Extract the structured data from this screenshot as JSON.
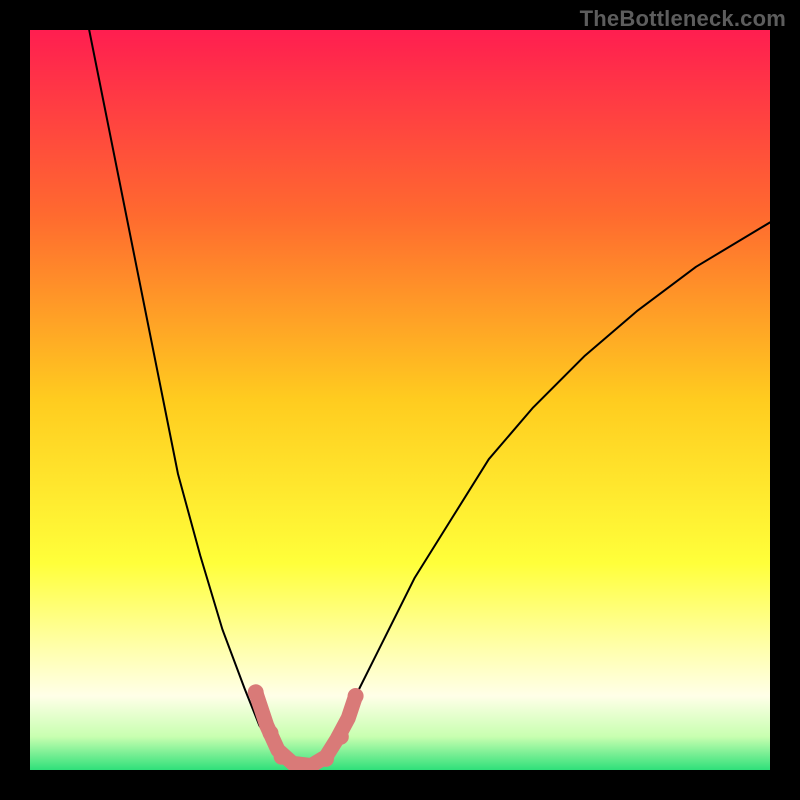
{
  "watermark": "TheBottleneck.com",
  "chart_data": {
    "type": "line",
    "title": "",
    "xlabel": "",
    "ylabel": "",
    "xlim": [
      0,
      100
    ],
    "ylim": [
      0,
      100
    ],
    "background_gradient": [
      {
        "pos": 0.0,
        "color": "#ff1e50"
      },
      {
        "pos": 0.25,
        "color": "#ff6a2f"
      },
      {
        "pos": 0.5,
        "color": "#ffcc1f"
      },
      {
        "pos": 0.72,
        "color": "#ffff3a"
      },
      {
        "pos": 0.84,
        "color": "#ffffb0"
      },
      {
        "pos": 0.9,
        "color": "#ffffe8"
      },
      {
        "pos": 0.955,
        "color": "#c8ffb0"
      },
      {
        "pos": 1.0,
        "color": "#2fe07a"
      }
    ],
    "series": [
      {
        "name": "left-curve",
        "color": "#000000",
        "width": 2,
        "points": [
          {
            "x": 8,
            "y": 100
          },
          {
            "x": 10,
            "y": 90
          },
          {
            "x": 12,
            "y": 80
          },
          {
            "x": 14,
            "y": 70
          },
          {
            "x": 16,
            "y": 60
          },
          {
            "x": 18,
            "y": 50
          },
          {
            "x": 20,
            "y": 40
          },
          {
            "x": 23,
            "y": 29
          },
          {
            "x": 26,
            "y": 19
          },
          {
            "x": 29,
            "y": 11
          },
          {
            "x": 31,
            "y": 6
          },
          {
            "x": 33,
            "y": 3
          },
          {
            "x": 35,
            "y": 1
          },
          {
            "x": 37,
            "y": 0
          }
        ]
      },
      {
        "name": "right-curve",
        "color": "#000000",
        "width": 2,
        "points": [
          {
            "x": 37,
            "y": 0
          },
          {
            "x": 39,
            "y": 1
          },
          {
            "x": 41,
            "y": 4
          },
          {
            "x": 44,
            "y": 10
          },
          {
            "x": 48,
            "y": 18
          },
          {
            "x": 52,
            "y": 26
          },
          {
            "x": 57,
            "y": 34
          },
          {
            "x": 62,
            "y": 42
          },
          {
            "x": 68,
            "y": 49
          },
          {
            "x": 75,
            "y": 56
          },
          {
            "x": 82,
            "y": 62
          },
          {
            "x": 90,
            "y": 68
          },
          {
            "x": 100,
            "y": 74
          }
        ]
      },
      {
        "name": "marker-trail",
        "color": "#d97a78",
        "width": 15,
        "points": [
          {
            "x": 30.5,
            "y": 10.5
          },
          {
            "x": 32.0,
            "y": 6.0
          },
          {
            "x": 33.5,
            "y": 2.7
          },
          {
            "x": 35.5,
            "y": 0.9
          },
          {
            "x": 38.0,
            "y": 0.6
          },
          {
            "x": 40.0,
            "y": 1.8
          },
          {
            "x": 41.5,
            "y": 4.2
          },
          {
            "x": 43.0,
            "y": 7.0
          },
          {
            "x": 44.0,
            "y": 10.0
          }
        ]
      }
    ],
    "markers": [
      {
        "x": 30.5,
        "y": 10.5,
        "r": 8,
        "color": "#d97a78"
      },
      {
        "x": 32.5,
        "y": 5.0,
        "r": 8,
        "color": "#d97a78"
      },
      {
        "x": 34.0,
        "y": 1.8,
        "r": 8,
        "color": "#d97a78"
      },
      {
        "x": 37.0,
        "y": 0.5,
        "r": 8,
        "color": "#d97a78"
      },
      {
        "x": 40.0,
        "y": 1.5,
        "r": 8,
        "color": "#d97a78"
      },
      {
        "x": 42.0,
        "y": 4.5,
        "r": 8,
        "color": "#d97a78"
      },
      {
        "x": 44.0,
        "y": 10.0,
        "r": 8,
        "color": "#d97a78"
      }
    ]
  }
}
